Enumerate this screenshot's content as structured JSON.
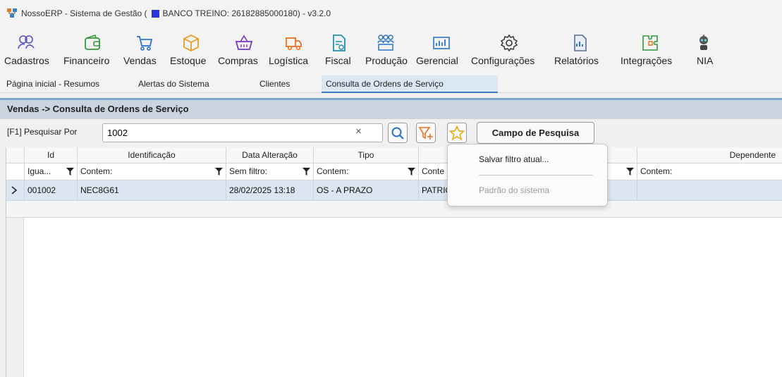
{
  "window": {
    "title_prefix": "NossoERP - Sistema de Gestão (",
    "title_suffix": "BANCO TREINO: 26182885000180) - v3.2.0"
  },
  "ribbon": {
    "items": [
      {
        "label": "Cadastros",
        "icon": "users-icon"
      },
      {
        "label": "Financeiro",
        "icon": "wallet-icon"
      },
      {
        "label": "Vendas",
        "icon": "cart-icon"
      },
      {
        "label": "Estoque",
        "icon": "box-icon"
      },
      {
        "label": "Compras",
        "icon": "basket-icon"
      },
      {
        "label": "Logística",
        "icon": "truck-icon"
      },
      {
        "label": "Fiscal",
        "icon": "document-icon"
      },
      {
        "label": "Produção",
        "icon": "people-group-icon"
      },
      {
        "label": "Gerencial",
        "icon": "chart-icon"
      },
      {
        "label": "Configurações",
        "icon": "gear-icon"
      },
      {
        "label": "Relatórios",
        "icon": "report-icon"
      },
      {
        "label": "Integrações",
        "icon": "puzzle-icon"
      },
      {
        "label": "NIA",
        "icon": "robot-icon"
      }
    ]
  },
  "tabs": [
    {
      "label": "Página inicial - Resumos"
    },
    {
      "label": "Alertas do Sistema"
    },
    {
      "label": "Clientes"
    },
    {
      "label": "Consulta de Ordens de Serviço"
    }
  ],
  "screen": {
    "title": "Vendas -> Consulta de Ordens de Serviço"
  },
  "search": {
    "label": "[F1] Pesquisar Por",
    "value": "1002",
    "clear": "×",
    "field_button": "Campo de Pesquisa"
  },
  "grid": {
    "columns": [
      "Id",
      "Identificação",
      "Data Alteração",
      "Tipo",
      "Dependente"
    ],
    "filters": [
      "Igua...",
      "Contem:",
      "Sem filtro:",
      "Contem:",
      "Conte",
      "Contem:"
    ],
    "row": {
      "id": "001002",
      "identificacao": "NEC8G61",
      "data": "28/02/2025 13:18",
      "tipo": "OS - A PRAZO",
      "cliente": "PATRIC"
    }
  },
  "popup_menu": {
    "save": "Salvar filtro atual...",
    "default": "Padrão do sistema"
  },
  "colors": {
    "accent": "#3a7fc4",
    "header_bar": "#c9d4df",
    "selected_row": "#dbe6f2",
    "db_marker": "#2b36d9"
  }
}
